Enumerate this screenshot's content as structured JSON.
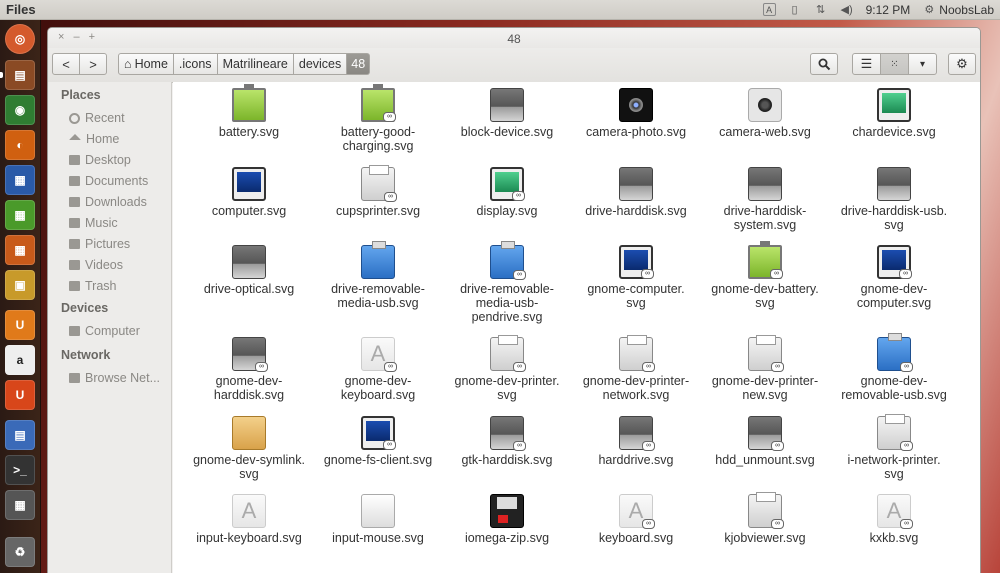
{
  "top_panel": {
    "app_title": "Files",
    "time": "9:12 PM",
    "user": "NoobsLab"
  },
  "window": {
    "title": "48",
    "controls": [
      "×",
      "–",
      "+"
    ]
  },
  "toolbar": {
    "back": "<",
    "forward": ">",
    "breadcrumbs": [
      "Home",
      ".icons",
      "Matrilineare",
      "devices",
      "48"
    ]
  },
  "sidebar": {
    "places_header": "Places",
    "places": [
      "Recent",
      "Home",
      "Desktop",
      "Documents",
      "Downloads",
      "Music",
      "Pictures",
      "Videos",
      "Trash"
    ],
    "devices_header": "Devices",
    "devices": [
      "Computer"
    ],
    "network_header": "Network",
    "network": [
      "Browse Net..."
    ]
  },
  "files": [
    {
      "name": "battery.svg",
      "lines": [
        "battery.svg"
      ],
      "icon": "battery",
      "link": false
    },
    {
      "name": "battery-good-charging.svg",
      "lines": [
        "battery-good-",
        "charging.svg"
      ],
      "icon": "battery",
      "link": true
    },
    {
      "name": "block-device.svg",
      "lines": [
        "block-device.svg"
      ],
      "icon": "drive",
      "link": false
    },
    {
      "name": "camera-photo.svg",
      "lines": [
        "camera-photo.svg"
      ],
      "icon": "camera",
      "link": false
    },
    {
      "name": "camera-web.svg",
      "lines": [
        "camera-web.svg"
      ],
      "icon": "webcam",
      "link": false
    },
    {
      "name": "chardevice.svg",
      "lines": [
        "chardevice.svg"
      ],
      "icon": "monitor-green",
      "link": false
    },
    {
      "name": "computer.svg",
      "lines": [
        "computer.svg"
      ],
      "icon": "monitor",
      "link": false
    },
    {
      "name": "cupsprinter.svg",
      "lines": [
        "cupsprinter.svg"
      ],
      "icon": "printer",
      "link": true
    },
    {
      "name": "display.svg",
      "lines": [
        "display.svg"
      ],
      "icon": "monitor-green",
      "link": true
    },
    {
      "name": "drive-harddisk.svg",
      "lines": [
        "drive-harddisk.svg"
      ],
      "icon": "drive",
      "link": false
    },
    {
      "name": "drive-harddisk-system.svg",
      "lines": [
        "drive-harddisk-",
        "system.svg"
      ],
      "icon": "drive",
      "link": false
    },
    {
      "name": "drive-harddisk-usb.svg",
      "lines": [
        "drive-harddisk-usb.",
        "svg"
      ],
      "icon": "drive",
      "link": false
    },
    {
      "name": "drive-optical.svg",
      "lines": [
        "drive-optical.svg"
      ],
      "icon": "drive",
      "link": false
    },
    {
      "name": "drive-removable-media-usb.svg",
      "lines": [
        "drive-removable-",
        "media-usb.svg"
      ],
      "icon": "usb",
      "link": false
    },
    {
      "name": "drive-removable-media-usb-pendrive.svg",
      "lines": [
        "drive-removable-",
        "media-usb-",
        "pendrive.svg"
      ],
      "icon": "usb",
      "link": true
    },
    {
      "name": "gnome-computer.svg",
      "lines": [
        "gnome-computer.",
        "svg"
      ],
      "icon": "monitor",
      "link": true
    },
    {
      "name": "gnome-dev-battery.svg",
      "lines": [
        "gnome-dev-battery.",
        "svg"
      ],
      "icon": "battery",
      "link": true
    },
    {
      "name": "gnome-dev-computer.svg",
      "lines": [
        "gnome-dev-",
        "computer.svg"
      ],
      "icon": "monitor",
      "link": true
    },
    {
      "name": "gnome-dev-harddisk.svg",
      "lines": [
        "gnome-dev-",
        "harddisk.svg"
      ],
      "icon": "drive",
      "link": true
    },
    {
      "name": "gnome-dev-keyboard.svg",
      "lines": [
        "gnome-dev-",
        "keyboard.svg"
      ],
      "icon": "font",
      "link": true
    },
    {
      "name": "gnome-dev-printer.svg",
      "lines": [
        "gnome-dev-printer.",
        "svg"
      ],
      "icon": "printer",
      "link": true
    },
    {
      "name": "gnome-dev-printer-network.svg",
      "lines": [
        "gnome-dev-printer-",
        "network.svg"
      ],
      "icon": "printer",
      "link": true
    },
    {
      "name": "gnome-dev-printer-new.svg",
      "lines": [
        "gnome-dev-printer-",
        "new.svg"
      ],
      "icon": "printer",
      "link": true
    },
    {
      "name": "gnome-dev-removable-usb.svg",
      "lines": [
        "gnome-dev-",
        "removable-usb.svg"
      ],
      "icon": "usb",
      "link": true
    },
    {
      "name": "gnome-dev-symlink.svg",
      "lines": [
        "gnome-dev-symlink.",
        "svg"
      ],
      "icon": "folder",
      "link": false
    },
    {
      "name": "gnome-fs-client.svg",
      "lines": [
        "gnome-fs-client.svg"
      ],
      "icon": "monitor",
      "link": true
    },
    {
      "name": "gtk-harddisk.svg",
      "lines": [
        "gtk-harddisk.svg"
      ],
      "icon": "drive",
      "link": true
    },
    {
      "name": "harddrive.svg",
      "lines": [
        "harddrive.svg"
      ],
      "icon": "drive",
      "link": true
    },
    {
      "name": "hdd_unmount.svg",
      "lines": [
        "hdd_unmount.svg"
      ],
      "icon": "drive",
      "link": true
    },
    {
      "name": "i-network-printer.svg",
      "lines": [
        "i-network-printer.",
        "svg"
      ],
      "icon": "printer",
      "link": true
    },
    {
      "name": "input-keyboard.svg",
      "lines": [
        "input-keyboard.svg"
      ],
      "icon": "font",
      "link": false
    },
    {
      "name": "input-mouse.svg",
      "lines": [
        "input-mouse.svg"
      ],
      "icon": "mouse",
      "link": false
    },
    {
      "name": "iomega-zip.svg",
      "lines": [
        "iomega-zip.svg"
      ],
      "icon": "floppy",
      "link": false
    },
    {
      "name": "keyboard.svg",
      "lines": [
        "keyboard.svg"
      ],
      "icon": "font",
      "link": true
    },
    {
      "name": "kjobviewer.svg",
      "lines": [
        "kjobviewer.svg"
      ],
      "icon": "printer",
      "link": true
    },
    {
      "name": "kxkb.svg",
      "lines": [
        "kxkb.svg"
      ],
      "icon": "font",
      "link": true
    }
  ]
}
